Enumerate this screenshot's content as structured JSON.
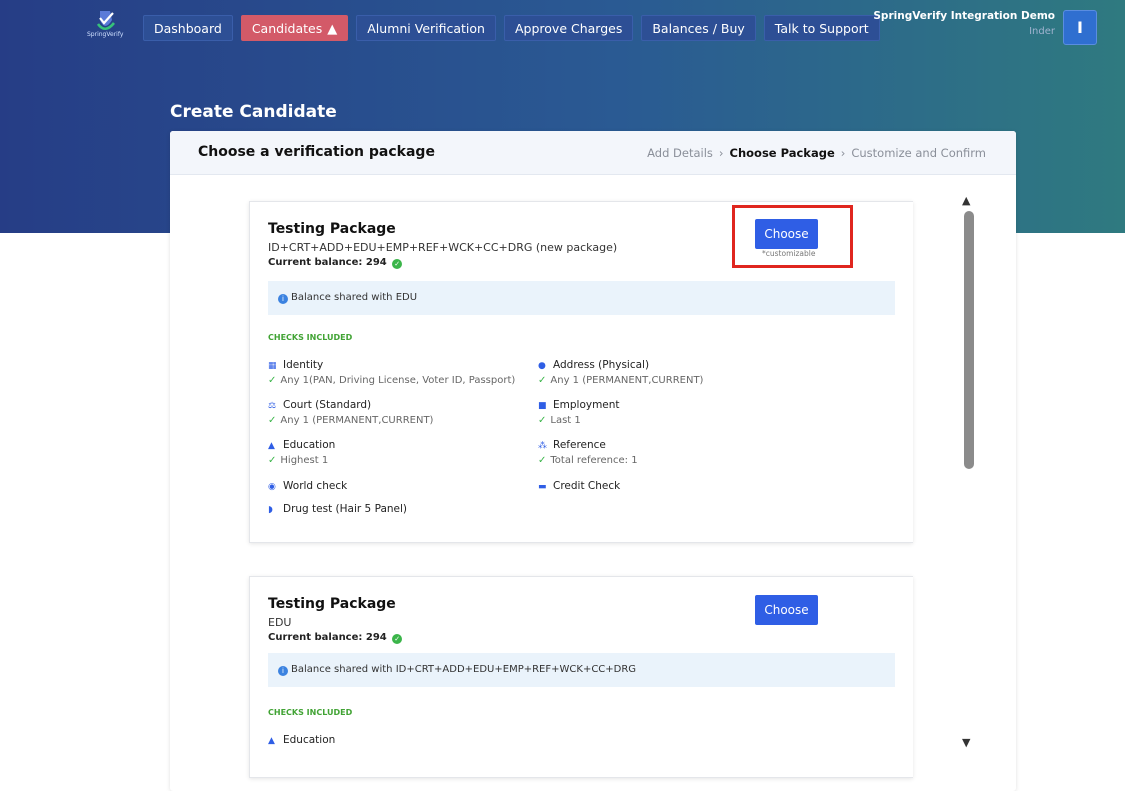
{
  "brand": {
    "logo_text": "SpringVerify"
  },
  "nav": [
    {
      "label": "Dashboard",
      "active": false
    },
    {
      "label": "Candidates",
      "active": true
    },
    {
      "label": "Alumni Verification",
      "active": false
    },
    {
      "label": "Approve Charges",
      "active": false
    },
    {
      "label": "Balances / Buy",
      "active": false
    },
    {
      "label": "Talk to Support",
      "active": false
    }
  ],
  "user": {
    "org": "SpringVerify Integration Demo",
    "name": "Inder",
    "initial": "I"
  },
  "page": {
    "title": "Create Candidate"
  },
  "card": {
    "title": "Choose a verification package",
    "steps": [
      "Add Details",
      "Choose Package",
      "Customize and Confirm"
    ],
    "current_step": "Choose Package",
    "step_separator": "›"
  },
  "packages": [
    {
      "name": "Testing Package",
      "code": "ID+CRT+ADD+EDU+EMP+REF+WCK+CC+DRG (new package)",
      "balance_label": "Current balance: 294",
      "choose_label": "Choose",
      "customizable_label": "*customizable",
      "info": "Balance shared with EDU",
      "checks_label": "CHECKS INCLUDED",
      "checks": [
        {
          "name": "Identity",
          "icon": "id-card-icon",
          "detail": "Any 1(PAN, Driving License, Voter ID, Passport)"
        },
        {
          "name": "Address (Physical)",
          "icon": "location-pin-icon",
          "detail": "Any 1 (PERMANENT,CURRENT)"
        },
        {
          "name": "Court (Standard)",
          "icon": "gavel-icon",
          "detail": "Any 1 (PERMANENT,CURRENT)"
        },
        {
          "name": "Employment",
          "icon": "briefcase-icon",
          "detail": "Last 1"
        },
        {
          "name": "Education",
          "icon": "graduation-cap-icon",
          "detail": "Highest 1"
        },
        {
          "name": "Reference",
          "icon": "people-icon",
          "detail": "Total reference: 1"
        },
        {
          "name": "World check",
          "icon": "globe-icon",
          "detail": ""
        },
        {
          "name": "Credit Check",
          "icon": "credit-card-icon",
          "detail": ""
        },
        {
          "name": "Drug test (Hair 5 Panel)",
          "icon": "pill-icon",
          "detail": ""
        }
      ]
    },
    {
      "name": "Testing Package",
      "code": "EDU",
      "balance_label": "Current balance: 294",
      "choose_label": "Choose",
      "info": "Balance shared with ID+CRT+ADD+EDU+EMP+REF+WCK+CC+DRG",
      "checks_label": "CHECKS INCLUDED",
      "checks": [
        {
          "name": "Education",
          "icon": "graduation-cap-icon",
          "detail": ""
        }
      ]
    }
  ],
  "colors": {
    "nav_bg": "#2d4f95",
    "nav_active": "#d35a68",
    "primary_button": "#2f5ee5",
    "highlight": "#e0261f",
    "checks_label": "#41a334"
  }
}
